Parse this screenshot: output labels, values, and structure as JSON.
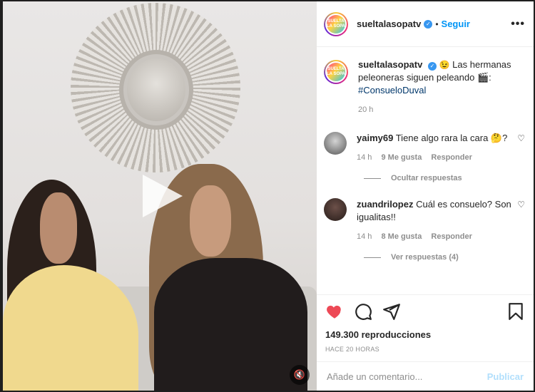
{
  "post": {
    "username": "sueltalasopatv",
    "follow_label": "Seguir",
    "more_label": "•••",
    "avatar_logo_text": "SUELTA LA SOPA",
    "caption_emoji": "😉",
    "caption_text": "Las hermanas peleoneras siguen peleando 🎬:",
    "caption_hashtag": "#ConsueloDuval",
    "caption_time": "20 h"
  },
  "comments": [
    {
      "user": "yaimy69",
      "text": "Tiene algo rara la cara 🤔?",
      "time": "14 h",
      "likes": "9 Me gusta",
      "reply_label": "Responder",
      "replies_toggle": "Ocultar respuestas"
    },
    {
      "user": "zuandrilopez",
      "text": "Cuál es consuelo? Son igualitas!!",
      "time": "14 h",
      "likes": "8 Me gusta",
      "reply_label": "Responder",
      "replies_toggle": "Ver respuestas (4)"
    }
  ],
  "actions": {
    "views": "149.300 reproducciones",
    "time_ago": "HACE 20 HORAS",
    "like_color": "#ed4956"
  },
  "comment_box": {
    "placeholder": "Añade un comentario...",
    "publish_label": "Publicar"
  },
  "video": {
    "play_icon": "play-icon",
    "mute_icon": "mute-icon"
  },
  "colors": {
    "link": "#0095f6",
    "hashtag": "#00376b",
    "muted": "#8e8e8e"
  }
}
